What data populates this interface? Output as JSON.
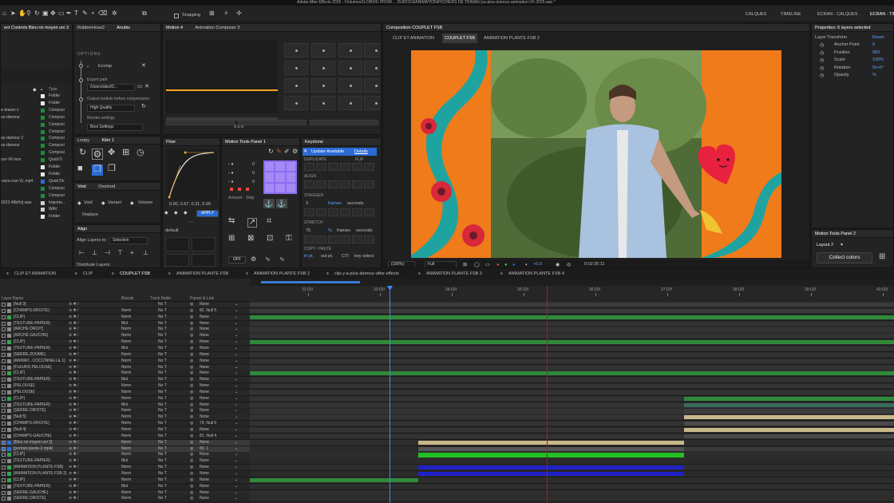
{
  "app": {
    "title": "Adobe After Effects 2025 - /Volumes/G-DRIVE PROM ... DURCES/ANIMATION/FICHIERS DE TRAVAIL/ya-plus-damour-animation-VF-2025.aep *",
    "snapping_label": "Snapping",
    "workspaces": [
      "CALQUES",
      "TIMELINE",
      "ECRAN - CALQUES",
      "ECRAN - TIMI"
    ]
  },
  "effect_controls": {
    "title": "ect Controls Bleu roi moyen uni 3",
    "type_header": "Type",
    "items": [
      {
        "name": "",
        "type": "Folder",
        "color": "#e8e8e8"
      },
      {
        "name": "",
        "type": "Folder",
        "color": "#e8e8e8"
      },
      {
        "name": "e-teaser-1",
        "type": "Composi",
        "color": "#1e8a3a"
      },
      {
        "name": "us-damour",
        "type": "Composi",
        "color": "#1e8a3a"
      },
      {
        "name": "",
        "type": "Composi",
        "color": "#1e8a3a"
      },
      {
        "name": "",
        "type": "Composi",
        "color": "#1e8a3a"
      },
      {
        "name": "us-damour 2",
        "type": "Composi",
        "color": "#1e8a3a"
      },
      {
        "name": "us-damour",
        "type": "Composi",
        "color": "#1e8a3a"
      },
      {
        "name": "",
        "type": "Composi",
        "color": "#1e8a3a"
      },
      {
        "name": "our-VF.mov",
        "type": "QuickTi",
        "color": "#1e8a3a"
      },
      {
        "name": "",
        "type": "Folder",
        "color": "#e8e8e8"
      },
      {
        "name": "",
        "type": "Folder",
        "color": "#e8e8e8"
      },
      {
        "name": "-ours-ouo-VL.mp4",
        "type": "QuickTin",
        "color": "#2a6bd6"
      },
      {
        "name": "",
        "type": "Composi",
        "color": "#1e8a3a"
      },
      {
        "name": "",
        "type": "Composi",
        "color": "#1e8a3a"
      },
      {
        "name": "2022-48kHz].wav",
        "type": "Importe...",
        "color": "#cfcfcf"
      },
      {
        "name": "",
        "type": "WAV",
        "color": "#cfcfcf"
      },
      {
        "name": "",
        "type": "Folder",
        "color": "#e8e8e8"
      }
    ]
  },
  "rubberhose": {
    "tabs": [
      "RubberHose2",
      "Anubis"
    ],
    "options_label": "OPTIONS",
    "comp_name": "Ecomp",
    "export_path_label": "Export path",
    "export_path_value": "/Users/alex/D...",
    "output_module_label": "Output module before compression",
    "quality_value": "High Quality",
    "render_settings_label": "Render settings",
    "render_settings_value": "Best Settings"
  },
  "motion4": {
    "tabs": [
      "Motion 4",
      "Animation Composer 3"
    ],
    "counter": "0  0  0"
  },
  "loopy": {
    "tabs": [
      "Loopy",
      "Kiler 1"
    ]
  },
  "void": {
    "tabs": [
      "Void",
      "Overlord"
    ],
    "options": [
      "Void",
      "Variant",
      "Volume"
    ],
    "replace_label": "Replace"
  },
  "align": {
    "title": "Align",
    "align_to_label": "Align Layers to:",
    "align_to_value": "Selection",
    "distribute_label": "Distribute Layers:"
  },
  "flow": {
    "title": "Flow",
    "values": "0.00, 0.67, 0.31, 0.99",
    "apply_label": "APPLY",
    "preset": "default"
  },
  "motion_tools": {
    "title": "Motion Tools Panel 1",
    "counters": [
      "0",
      "0",
      "0"
    ],
    "labels": [
      "Amount",
      "Step"
    ],
    "off_label": "OFF"
  },
  "keystone": {
    "title": "Keystone",
    "update_label": "Update Available",
    "details_label": "Details",
    "sections": [
      "DUPLICATE",
      "FLIP",
      "ALIGN",
      "STAGGER",
      "STRETCH",
      "COPY / PASTE"
    ],
    "stagger_value": "3",
    "stagger_units": [
      "frames",
      "seconds"
    ],
    "stretch_value": "75",
    "stretch_unit": "%",
    "stretch_units": [
      "frames",
      "seconds"
    ],
    "copy_paste_items": [
      "in pt.",
      "out pt.",
      "CTI",
      "key select"
    ]
  },
  "composition": {
    "title": "Composition COUPLET FSB",
    "tabs": [
      "CLIP ET ANIMATION",
      "COUPLET FSB",
      "ANIMATION PLANTE FSB 2"
    ],
    "zoom": "(100%)",
    "resolution": "Full",
    "exposure": "+0.0",
    "timecode": "0:02:35:11"
  },
  "properties": {
    "title": "Properties: 6 layers selected",
    "section": "Layer Transform",
    "reset_label": "Reset",
    "rows": [
      {
        "label": "Anchor Point",
        "value": "0"
      },
      {
        "label": "Position",
        "value": "960"
      },
      {
        "label": "Scale",
        "value": "100%"
      },
      {
        "label": "Rotation",
        "value": "0x+0°"
      },
      {
        "label": "Opacity",
        "value": "%"
      }
    ]
  },
  "motion_tools2": {
    "title": "Motion Tools Panel 2",
    "layout_label": "Layout 2",
    "collect_label": "Collect colors"
  },
  "timeline": {
    "tabs": [
      "CLIP ET ANIMATION",
      "CLIP",
      "COUPLET FSB",
      "ANIMATION PLANTE FSB",
      "ANIMATION PLANTE FSB 2",
      "clip-y-a-plus-damour-after-effects",
      "ANIMATION PLANTE FSB 3",
      "ANIMATION PLANTE FSB 4"
    ],
    "headers": {
      "layer_name": "Layer Name",
      "blend": "Blende",
      "track_matte": "Track Matte",
      "parent": "Parent & Link"
    },
    "ruler": [
      "32:02f",
      "33:02f",
      "34:02f",
      "35:02f",
      "36:02f",
      "37:02f",
      "38:02f",
      "39:02f",
      "40:02f"
    ],
    "layers": [
      {
        "name": "[Null 3]",
        "blend": "",
        "tm": "No T",
        "parent": "None",
        "label": "#8a8a8a"
      },
      {
        "name": "[CHAMPS-DROITE]",
        "blend": "Norm",
        "tm": "No T",
        "parent": "82. Null 5",
        "label": "#8a8a8a"
      },
      {
        "name": "[CLIP]",
        "blend": "Norm",
        "tm": "No T",
        "parent": "None",
        "label": "#2fa84f"
      },
      {
        "name": "[TEXTURE-PAPIER]",
        "blend": "Mul",
        "tm": "No T",
        "parent": "None",
        "label": "#8a8a8a"
      },
      {
        "name": "[ARCHE DROIT]",
        "blend": "Norm",
        "tm": "No T",
        "parent": "None",
        "label": "#8a8a8a"
      },
      {
        "name": "[ARCHE GAUCHE]",
        "blend": "Norm",
        "tm": "No T",
        "parent": "None",
        "label": "#8a8a8a"
      },
      {
        "name": "[CLIP]",
        "blend": "Norm",
        "tm": "No T",
        "parent": "None",
        "label": "#2fa84f"
      },
      {
        "name": "[TEXTURE-PAPIER]",
        "blend": "Mul",
        "tm": "No T",
        "parent": "None",
        "label": "#8a8a8a"
      },
      {
        "name": "[SERRE ZOOME]",
        "blend": "Norm",
        "tm": "No T",
        "parent": "None",
        "label": "#8a8a8a"
      },
      {
        "name": "[ANIMAT...COCCINNELLE 1]",
        "blend": "Norm",
        "tm": "No T",
        "parent": "None",
        "label": "#8a8a8a"
      },
      {
        "name": "[FLEURS PELOUSE]",
        "blend": "Norm",
        "tm": "No T",
        "parent": "None",
        "label": "#8a8a8a"
      },
      {
        "name": "[CLIP]",
        "blend": "Norm",
        "tm": "No T",
        "parent": "None",
        "label": "#2fa84f"
      },
      {
        "name": "[TEXTURE-PAPIER]",
        "blend": "Mul",
        "tm": "No T",
        "parent": "None",
        "label": "#8a8a8a"
      },
      {
        "name": "[PELOUSE]",
        "blend": "Norm",
        "tm": "No T",
        "parent": "None",
        "label": "#8a8a8a"
      },
      {
        "name": "[PELOUSE]",
        "blend": "Norm",
        "tm": "No T",
        "parent": "None",
        "label": "#8a8a8a"
      },
      {
        "name": "[CLIP]",
        "blend": "Norm",
        "tm": "No T",
        "parent": "None",
        "label": "#2fa84f"
      },
      {
        "name": "[TEXTURE-PAPIER]",
        "blend": "Mul",
        "tm": "No T",
        "parent": "None",
        "label": "#8a8a8a"
      },
      {
        "name": "[SERRE DROITE]",
        "blend": "Norm",
        "tm": "No T",
        "parent": "None",
        "label": "#8a8a8a"
      },
      {
        "name": "[Null 5]",
        "blend": "Norm",
        "tm": "No T",
        "parent": "None",
        "label": "#8a8a8a"
      },
      {
        "name": "[CHAMPS-DROITE]",
        "blend": "Norm",
        "tm": "No T",
        "parent": "79. Null 5",
        "label": "#8a8a8a"
      },
      {
        "name": "[Null 4]",
        "blend": "Norm",
        "tm": "No T",
        "parent": "None",
        "label": "#8a8a8a"
      },
      {
        "name": "[CHAMPS-GAUCHE]",
        "blend": "Norm",
        "tm": "No T",
        "parent": "81. Null 4",
        "label": "#8a8a8a"
      },
      {
        "name": "[Bleu roi moyen uni 3]",
        "blend": "Norm",
        "tm": "No T",
        "parent": "None",
        "label": "#2a6bd6"
      },
      {
        "name": "[portrait plante-2.mp4]",
        "blend": "Norm",
        "tm": "No T",
        "parent": "83. 1",
        "label": "#2a6bd6"
      },
      {
        "name": "[CLIP]",
        "blend": "Norm",
        "tm": "No T",
        "parent": "None",
        "label": "#2fa84f"
      },
      {
        "name": "[TEXTURE-PAPIER]",
        "blend": "Mul",
        "tm": "No T",
        "parent": "None",
        "label": "#8a8a8a"
      },
      {
        "name": "[ANIMATION PLANTE FSB]",
        "blend": "Norm",
        "tm": "No T",
        "parent": "None",
        "label": "#2fa84f"
      },
      {
        "name": "[ANIMATION PLANTE FSB 2]",
        "blend": "Norm",
        "tm": "No T",
        "parent": "None",
        "label": "#2fa84f"
      },
      {
        "name": "[CLIP]",
        "blend": "Norm",
        "tm": "No T",
        "parent": "None",
        "label": "#2fa84f"
      },
      {
        "name": "[TEXTURE-PAPIER]",
        "blend": "Mul",
        "tm": "No T",
        "parent": "None",
        "label": "#8a8a8a"
      },
      {
        "name": "[SERRE GAUCHE]",
        "blend": "Norm",
        "tm": "No T",
        "parent": "None",
        "label": "#8a8a8a"
      },
      {
        "name": "[SERRE DROITE]",
        "blend": "Norm",
        "tm": "No T",
        "parent": "None",
        "label": "#8a8a8a"
      }
    ]
  }
}
